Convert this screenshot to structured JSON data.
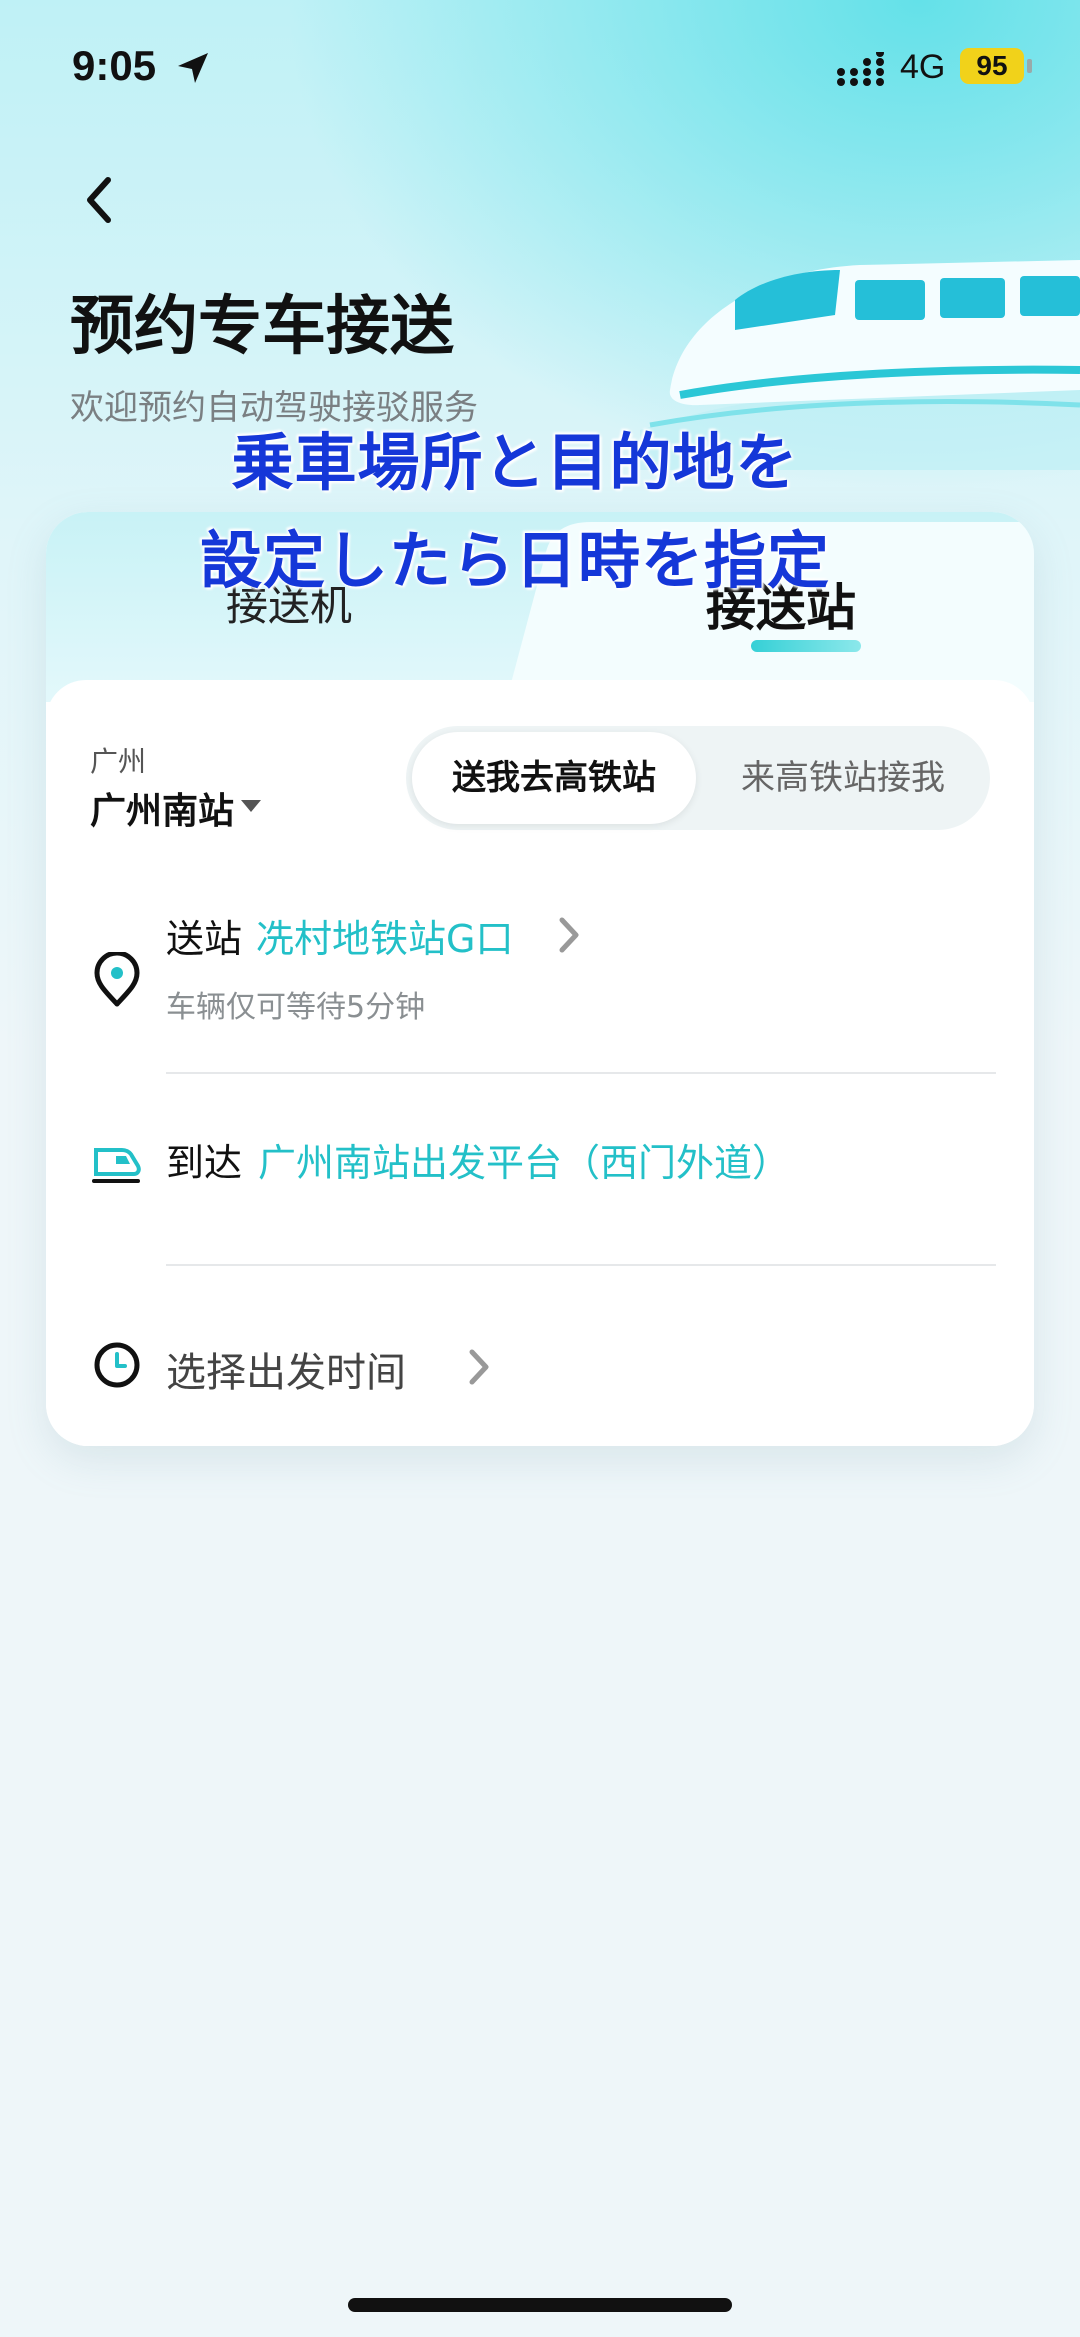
{
  "status": {
    "time": "9:05",
    "network": "4G",
    "battery": "95"
  },
  "header": {
    "title": "预约专车接送",
    "subtitle": "欢迎预约自动驾驶接驳服务"
  },
  "overlay": {
    "line1": "乗車場所と目的地を",
    "line2": "設定したら日時を指定"
  },
  "tabs": {
    "airport": "接送机",
    "station": "接送站"
  },
  "city": {
    "region": "广州",
    "station": "广州南站"
  },
  "segment": {
    "to_station": "送我去高铁站",
    "from_station": "来高铁站接我"
  },
  "pickup": {
    "label": "送站",
    "value": "冼村地铁站G口",
    "note": "车辆仅可等待5分钟"
  },
  "arrival": {
    "label": "到达",
    "value": "广州南站出发平台（西门外道）"
  },
  "departure": {
    "label": "选择出发时间"
  },
  "colors": {
    "accent": "#23c0c8",
    "overlay_text": "#1537d8",
    "battery": "#f1d21a"
  }
}
